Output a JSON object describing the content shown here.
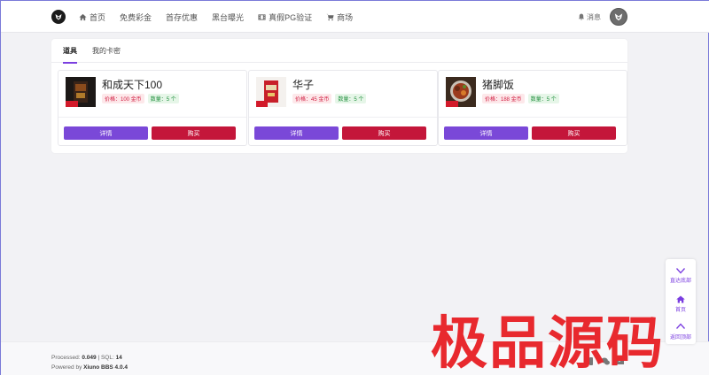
{
  "nav": {
    "items": [
      {
        "label": "首页",
        "icon": "home-icon"
      },
      {
        "label": "免费彩金",
        "icon": null
      },
      {
        "label": "首存优惠",
        "icon": null
      },
      {
        "label": "黑台曝光",
        "icon": null
      },
      {
        "label": "真假PG验证",
        "icon": "film-icon"
      },
      {
        "label": "商场",
        "icon": "cart-icon"
      }
    ],
    "message_label": "消息"
  },
  "tabs": [
    {
      "label": "道具",
      "active": true
    },
    {
      "label": "我的卡密",
      "active": false
    }
  ],
  "products": [
    {
      "name": "和成天下100",
      "price": "价格：100 金币",
      "qty": "数量：5 个",
      "detail_label": "详情",
      "buy_label": "购买"
    },
    {
      "name": "华子",
      "price": "价格：45 金币",
      "qty": "数量：5 个",
      "detail_label": "详情",
      "buy_label": "购买"
    },
    {
      "name": "猪脚饭",
      "price": "价格：188 金币",
      "qty": "数量：5 个",
      "detail_label": "详情",
      "buy_label": "购买"
    }
  ],
  "footer": {
    "processed_label": "Processed:",
    "processed_value": "0.049",
    "sql_label": "SQL:",
    "sql_value": "14",
    "powered_label": "Powered by",
    "powered_value": "Xiuno BBS 4.0.4"
  },
  "side": {
    "bottom_label": "直达底部",
    "home_label": "首页",
    "top_label": "返回顶部"
  },
  "watermark": "极品源码",
  "colors": {
    "accent": "#7a48d8",
    "buy": "#c4163a",
    "watermark": "#e8292e"
  }
}
